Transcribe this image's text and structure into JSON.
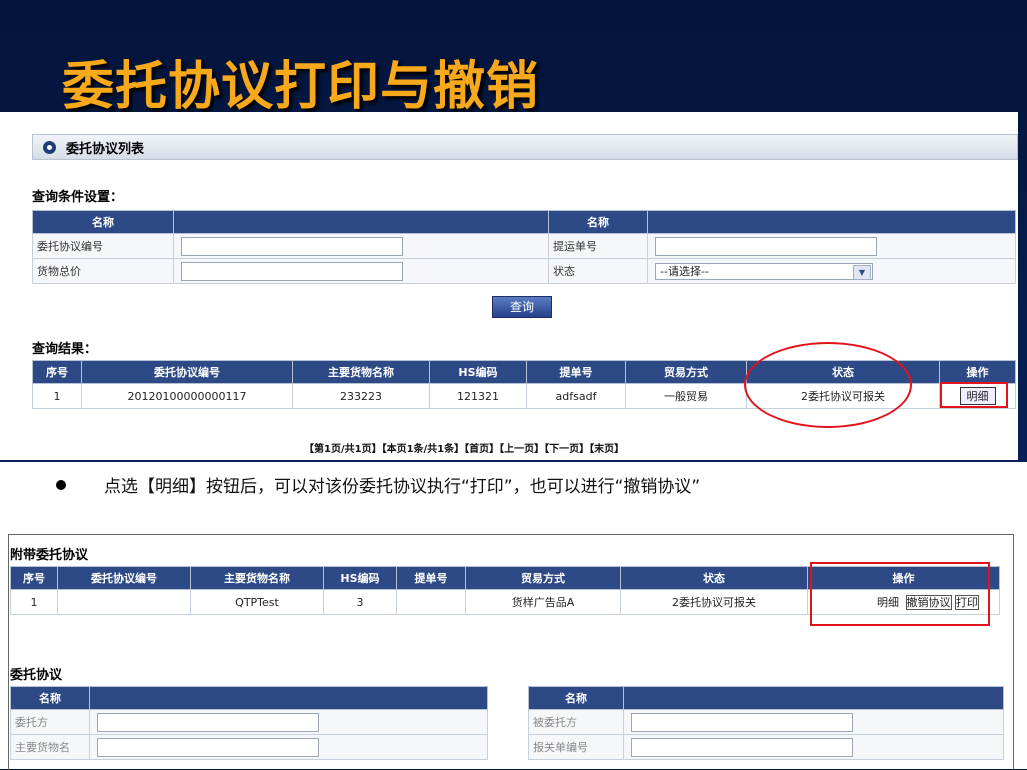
{
  "slide": {
    "title": "委托协议打印与撤销"
  },
  "top_panel": {
    "header": "委托协议列表",
    "query_label": "查询条件设置：",
    "query_headers": [
      "名称",
      "",
      "名称",
      ""
    ],
    "query_rows": [
      {
        "left_label": "委托协议编号",
        "right_label": "提运单号"
      },
      {
        "left_label": "货物总价",
        "right_label": "状态"
      }
    ],
    "status_select": "--请选择--",
    "query_button": "查询",
    "result_label": "查询结果：",
    "result_headers": [
      "序号",
      "委托协议编号",
      "主要货物名称",
      "HS编码",
      "提单号",
      "贸易方式",
      "状态",
      "操作"
    ],
    "result_rows": [
      {
        "seq": "1",
        "agreement_no": "20120100000000117",
        "goods": "233223",
        "hs": "121321",
        "bill": "adfsadf",
        "trade": "一般贸易",
        "status": "2委托协议可报关",
        "action": "明细"
      }
    ],
    "pager": "【第1页/共1页】【本页1条/共1条】【首页】【上一页】【下一页】【末页】"
  },
  "bullet": {
    "text": "点选【明细】按钮后，可以对该份委托协议执行“打印”，也可以进行“撤销协议”"
  },
  "bottom_panel": {
    "attached_label": "附带委托协议",
    "attached_headers": [
      "序号",
      "委托协议编号",
      "主要货物名称",
      "HS编码",
      "提单号",
      "贸易方式",
      "状态",
      "操作"
    ],
    "attached_rows": [
      {
        "seq": "1",
        "agreement_no": "",
        "goods": "QTPTest",
        "hs": "3",
        "bill": "",
        "trade": "货样广告品A",
        "status": "2委托协议可报关",
        "action_detail": "明细",
        "action_cancel": "撤销协议",
        "action_print": "打印"
      }
    ],
    "agreement_label": "委托协议",
    "left_headers": [
      "名称",
      ""
    ],
    "left_rows": [
      "委托方",
      "主要货物名"
    ],
    "right_headers": [
      "名称",
      ""
    ],
    "right_rows": [
      "被委托方",
      "报关单编号"
    ]
  },
  "colors": {
    "title": "#f7a81b",
    "header_bg": "#2e4a86",
    "highlight": "#e0141a",
    "slide_bg": "#03143a"
  }
}
